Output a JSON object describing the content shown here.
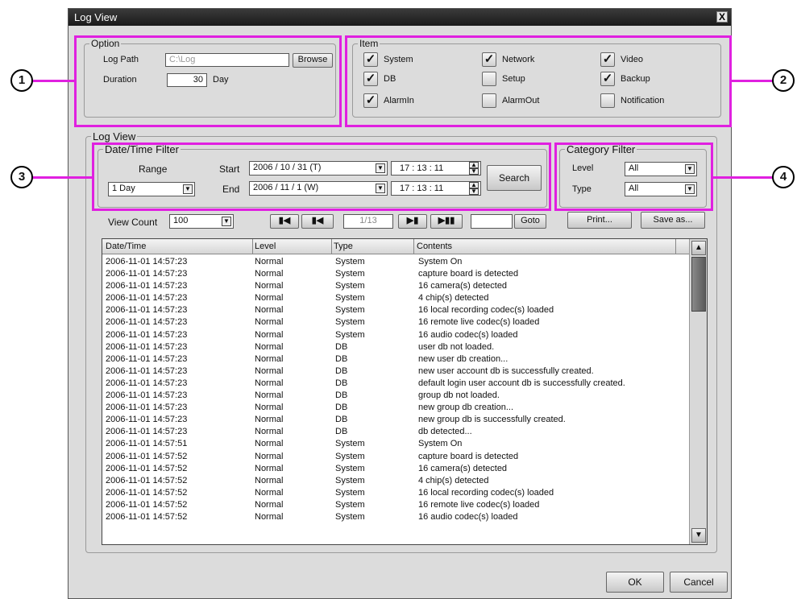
{
  "window": {
    "title": "Log View",
    "close": "X"
  },
  "option": {
    "group_title": "Option",
    "log_path_label": "Log Path",
    "log_path_value": "C:\\Log",
    "browse_label": "Browse",
    "duration_label": "Duration",
    "duration_value": "30",
    "duration_unit": "Day"
  },
  "item": {
    "group_title": "Item",
    "checks": [
      {
        "label": "System",
        "checked": true
      },
      {
        "label": "Network",
        "checked": true
      },
      {
        "label": "Video",
        "checked": true
      },
      {
        "label": "DB",
        "checked": true
      },
      {
        "label": "Setup",
        "checked": false
      },
      {
        "label": "Backup",
        "checked": true
      },
      {
        "label": "AlarmIn",
        "checked": true
      },
      {
        "label": "AlarmOut",
        "checked": false
      },
      {
        "label": "Notification",
        "checked": false
      }
    ]
  },
  "logview": {
    "group_title": "Log View"
  },
  "datetime": {
    "group_title": "Date/Time Filter",
    "range_label": "Range",
    "range_value": "1 Day",
    "start_label": "Start",
    "start_date": "2006  /  10  /  31   (T)",
    "start_time": "17 : 13 : 11",
    "end_label": "End",
    "end_date": "2006  /  11  /  1    (W)",
    "end_time": "17 : 13 : 11",
    "search_label": "Search"
  },
  "category": {
    "group_title": "Category Filter",
    "level_label": "Level",
    "level_value": "All",
    "type_label": "Type",
    "type_value": "All"
  },
  "nav": {
    "view_count_label": "View Count",
    "view_count_value": "100",
    "page_value": "1/13",
    "goto_label": "Goto",
    "print_label": "Print...",
    "saveas_label": "Save as..."
  },
  "table": {
    "columns": [
      "Date/Time",
      "Level",
      "Type",
      "Contents"
    ],
    "rows": [
      [
        "2006-11-01 14:57:23",
        "Normal",
        "System",
        "System On"
      ],
      [
        "2006-11-01 14:57:23",
        "Normal",
        "System",
        "capture board is detected"
      ],
      [
        "2006-11-01 14:57:23",
        "Normal",
        "System",
        "16 camera(s) detected"
      ],
      [
        "2006-11-01 14:57:23",
        "Normal",
        "System",
        "4 chip(s) detected"
      ],
      [
        "2006-11-01 14:57:23",
        "Normal",
        "System",
        "16 local recording codec(s) loaded"
      ],
      [
        "2006-11-01 14:57:23",
        "Normal",
        "System",
        "16 remote live codec(s) loaded"
      ],
      [
        "2006-11-01 14:57:23",
        "Normal",
        "System",
        "16 audio codec(s) loaded"
      ],
      [
        "2006-11-01 14:57:23",
        "Normal",
        "DB",
        "user db not loaded."
      ],
      [
        "2006-11-01 14:57:23",
        "Normal",
        "DB",
        "new user db creation..."
      ],
      [
        "2006-11-01 14:57:23",
        "Normal",
        "DB",
        "new user account db is successfully created."
      ],
      [
        "2006-11-01 14:57:23",
        "Normal",
        "DB",
        "default login user account db is successfully created."
      ],
      [
        "2006-11-01 14:57:23",
        "Normal",
        "DB",
        "group db not loaded."
      ],
      [
        "2006-11-01 14:57:23",
        "Normal",
        "DB",
        "new group db creation..."
      ],
      [
        "2006-11-01 14:57:23",
        "Normal",
        "DB",
        "new group db is successfully created."
      ],
      [
        "2006-11-01 14:57:23",
        "Normal",
        "DB",
        "db detected..."
      ],
      [
        "2006-11-01 14:57:51",
        "Normal",
        "System",
        "System On"
      ],
      [
        "2006-11-01 14:57:52",
        "Normal",
        "System",
        "capture board is detected"
      ],
      [
        "2006-11-01 14:57:52",
        "Normal",
        "System",
        "16 camera(s) detected"
      ],
      [
        "2006-11-01 14:57:52",
        "Normal",
        "System",
        "4 chip(s) detected"
      ],
      [
        "2006-11-01 14:57:52",
        "Normal",
        "System",
        "16 local recording codec(s) loaded"
      ],
      [
        "2006-11-01 14:57:52",
        "Normal",
        "System",
        "16 remote live codec(s) loaded"
      ],
      [
        "2006-11-01 14:57:52",
        "Normal",
        "System",
        "16 audio codec(s) loaded"
      ]
    ]
  },
  "footer": {
    "ok_label": "OK",
    "cancel_label": "Cancel"
  },
  "callouts": [
    "1",
    "2",
    "3",
    "4"
  ],
  "colors": {
    "highlight": "#e020e0",
    "titlebar": "#1a1a1a",
    "dialog_bg": "#dcdcdc"
  },
  "icons": {
    "dropdown": "triangle-down-icon",
    "first": "skip-first-icon",
    "prev": "prev-icon",
    "next": "next-icon",
    "last": "skip-last-icon"
  }
}
